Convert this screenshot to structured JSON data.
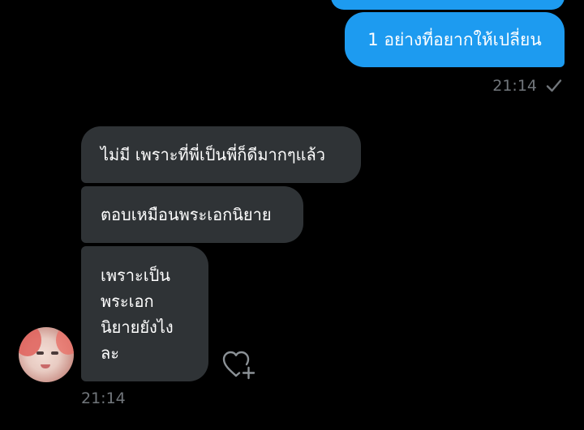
{
  "conversation": {
    "outgoing": {
      "message": "1 อย่างที่อยากให้เปลี่ยน",
      "time": "21:14",
      "status_icon": "check-icon"
    },
    "incoming": {
      "messages": [
        "ไม่มี เพราะที่พี่เป็นพี่ก็ดีมากๆแล้ว",
        "ตอบเหมือนพระเอกนิยาย"
      ],
      "last_message_lines": [
        "เพราะเป็น",
        "พระเอก",
        "นิยายยังไง",
        "ละ"
      ],
      "time": "21:14",
      "reaction_icon": "heart-plus-icon"
    }
  },
  "colors": {
    "background": "#000000",
    "outgoing_bubble": "#1d9bf0",
    "incoming_bubble": "#2f3336",
    "meta_text": "#71767b",
    "text": "#ffffff"
  }
}
